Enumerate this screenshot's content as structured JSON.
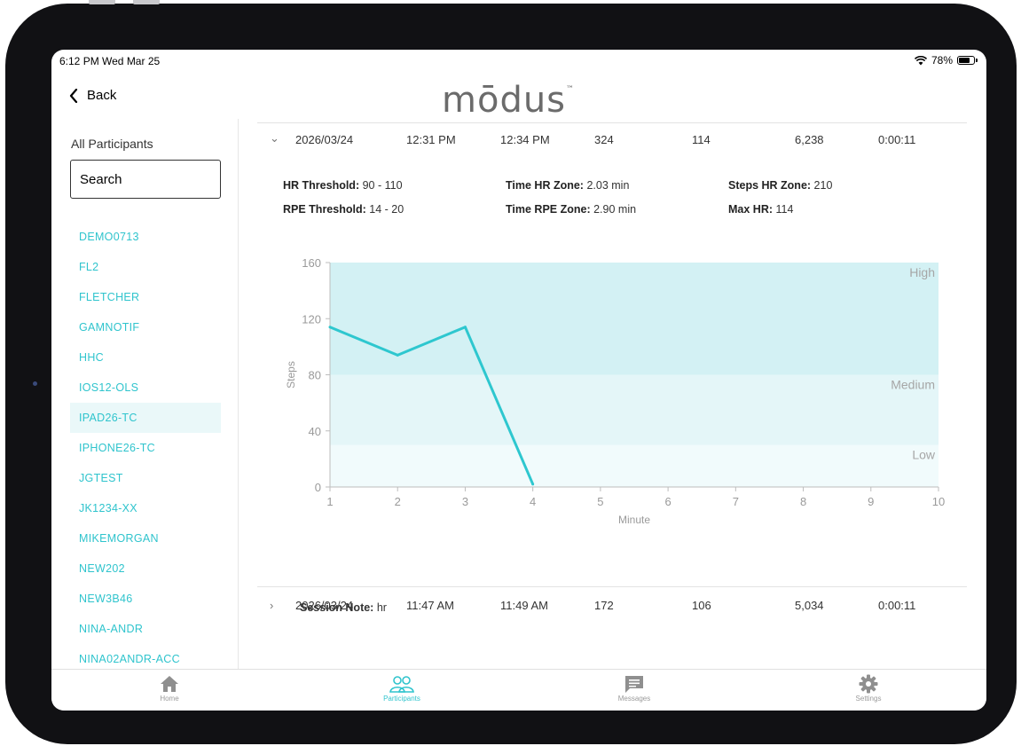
{
  "status": {
    "time": "6:12 PM  Wed Mar 25",
    "battery": "78%",
    "battery_level": 0.78
  },
  "nav": {
    "back_label": "Back",
    "logo": "mōdus",
    "logo_tm": "™"
  },
  "sidebar": {
    "title": "All Participants",
    "search_placeholder": "Search",
    "participants": [
      "DEMO0713",
      "FL2",
      "FLETCHER",
      "GAMNOTIF",
      "HHC",
      "IOS12-OLS",
      "IPAD26-TC",
      "IPHONE26-TC",
      "JGTEST",
      "JK1234-XX",
      "MIKEMORGAN",
      "NEW202",
      "NEW3B46",
      "NINA-ANDR",
      "NINA02ANDR-ACC"
    ],
    "selected": "IPAD26-TC"
  },
  "sessions": [
    {
      "date": "2026/03/24",
      "start": "12:31 PM",
      "end": "12:34 PM",
      "v1": "324",
      "v2": "114",
      "steps": "6,238",
      "duration": "0:00:11",
      "expanded": true
    },
    {
      "date": "2026/03/24",
      "start": "11:47 AM",
      "end": "11:49 AM",
      "v1": "172",
      "v2": "106",
      "steps": "5,034",
      "duration": "0:00:11",
      "expanded": false
    }
  ],
  "details": {
    "hr_threshold_label": "HR Threshold:",
    "hr_threshold": "90 - 110",
    "time_hr_zone_label": "Time HR Zone:",
    "time_hr_zone": "2.03 min",
    "steps_hr_zone_label": "Steps HR Zone:",
    "steps_hr_zone": "210",
    "rpe_threshold_label": "RPE Threshold:",
    "rpe_threshold": "14 - 20",
    "time_rpe_zone_label": "Time RPE Zone:",
    "time_rpe_zone": "2.90 min",
    "max_hr_label": "Max HR:",
    "max_hr": "114",
    "session_note_label": "Session Note:",
    "session_note": "hr"
  },
  "chart_data": {
    "type": "line",
    "xlabel": "Minute",
    "ylabel": "Steps",
    "xlim": [
      1,
      10
    ],
    "ylim": [
      0,
      160
    ],
    "x_ticks": [
      1,
      2,
      3,
      4,
      5,
      6,
      7,
      8,
      9,
      10
    ],
    "y_ticks": [
      0,
      40,
      80,
      120,
      160
    ],
    "x": [
      1,
      2,
      3,
      4
    ],
    "y": [
      114,
      94,
      114,
      2
    ],
    "zones": [
      {
        "name": "Low",
        "from": 0,
        "to": 30,
        "color": "#f1fbfc"
      },
      {
        "name": "Medium",
        "from": 30,
        "to": 80,
        "color": "#e4f6f8"
      },
      {
        "name": "High",
        "from": 80,
        "to": 160,
        "color": "#d3f1f4"
      }
    ],
    "line_color": "#2ec7cf"
  },
  "tabs": [
    {
      "label": "Home",
      "icon": "home-icon"
    },
    {
      "label": "Participants",
      "icon": "participants-icon",
      "active": true
    },
    {
      "label": "Messages",
      "icon": "messages-icon"
    },
    {
      "label": "Settings",
      "icon": "gear-icon"
    }
  ]
}
